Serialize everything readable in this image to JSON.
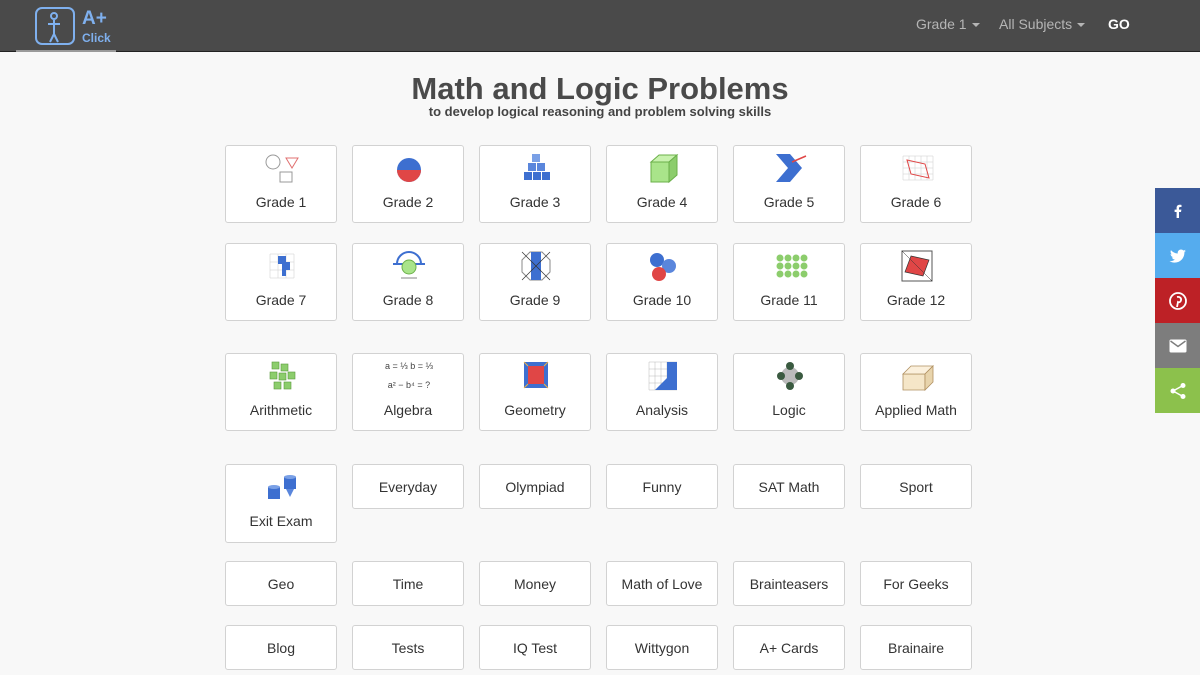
{
  "brand": {
    "logo_text": "A+",
    "logo_sub": "Click"
  },
  "nav": {
    "grade_label": "Grade 1",
    "subjects_label": "All Subjects",
    "go_label": "GO"
  },
  "header": {
    "title": "Math and Logic Problems",
    "subtitle": "to develop logical reasoning and problem solving skills"
  },
  "grades": [
    "Grade 1",
    "Grade 2",
    "Grade 3",
    "Grade 4",
    "Grade 5",
    "Grade 6",
    "Grade 7",
    "Grade 8",
    "Grade 9",
    "Grade 10",
    "Grade 11",
    "Grade 12"
  ],
  "subjects": [
    "Arithmetic",
    "Algebra",
    "Geometry",
    "Analysis",
    "Logic",
    "Applied Math"
  ],
  "exit_exam": "Exit Exam",
  "topics_row1": [
    "Everyday",
    "Olympiad",
    "Funny",
    "SAT Math",
    "Sport"
  ],
  "topics_row2": [
    "Geo",
    "Time",
    "Money",
    "Math of Love",
    "Brainteasers",
    "For Geeks"
  ],
  "topics_row3": [
    "Blog",
    "Tests",
    "IQ Test",
    "Wittygon",
    "A+ Cards",
    "Brainaire"
  ],
  "icons": {
    "algebra_line1": "a = ⅓   b = ⅓",
    "algebra_line2": "a² − b⁴ = ?"
  },
  "colors": {
    "navbar": "#4a4a4a",
    "facebook": "#3b5998",
    "twitter": "#55acee",
    "pinterest": "#bd2126",
    "email": "#7d7d7d",
    "share": "#8cc14c"
  },
  "social_icons": [
    "facebook-icon",
    "twitter-icon",
    "pinterest-icon",
    "email-icon",
    "share-icon"
  ]
}
